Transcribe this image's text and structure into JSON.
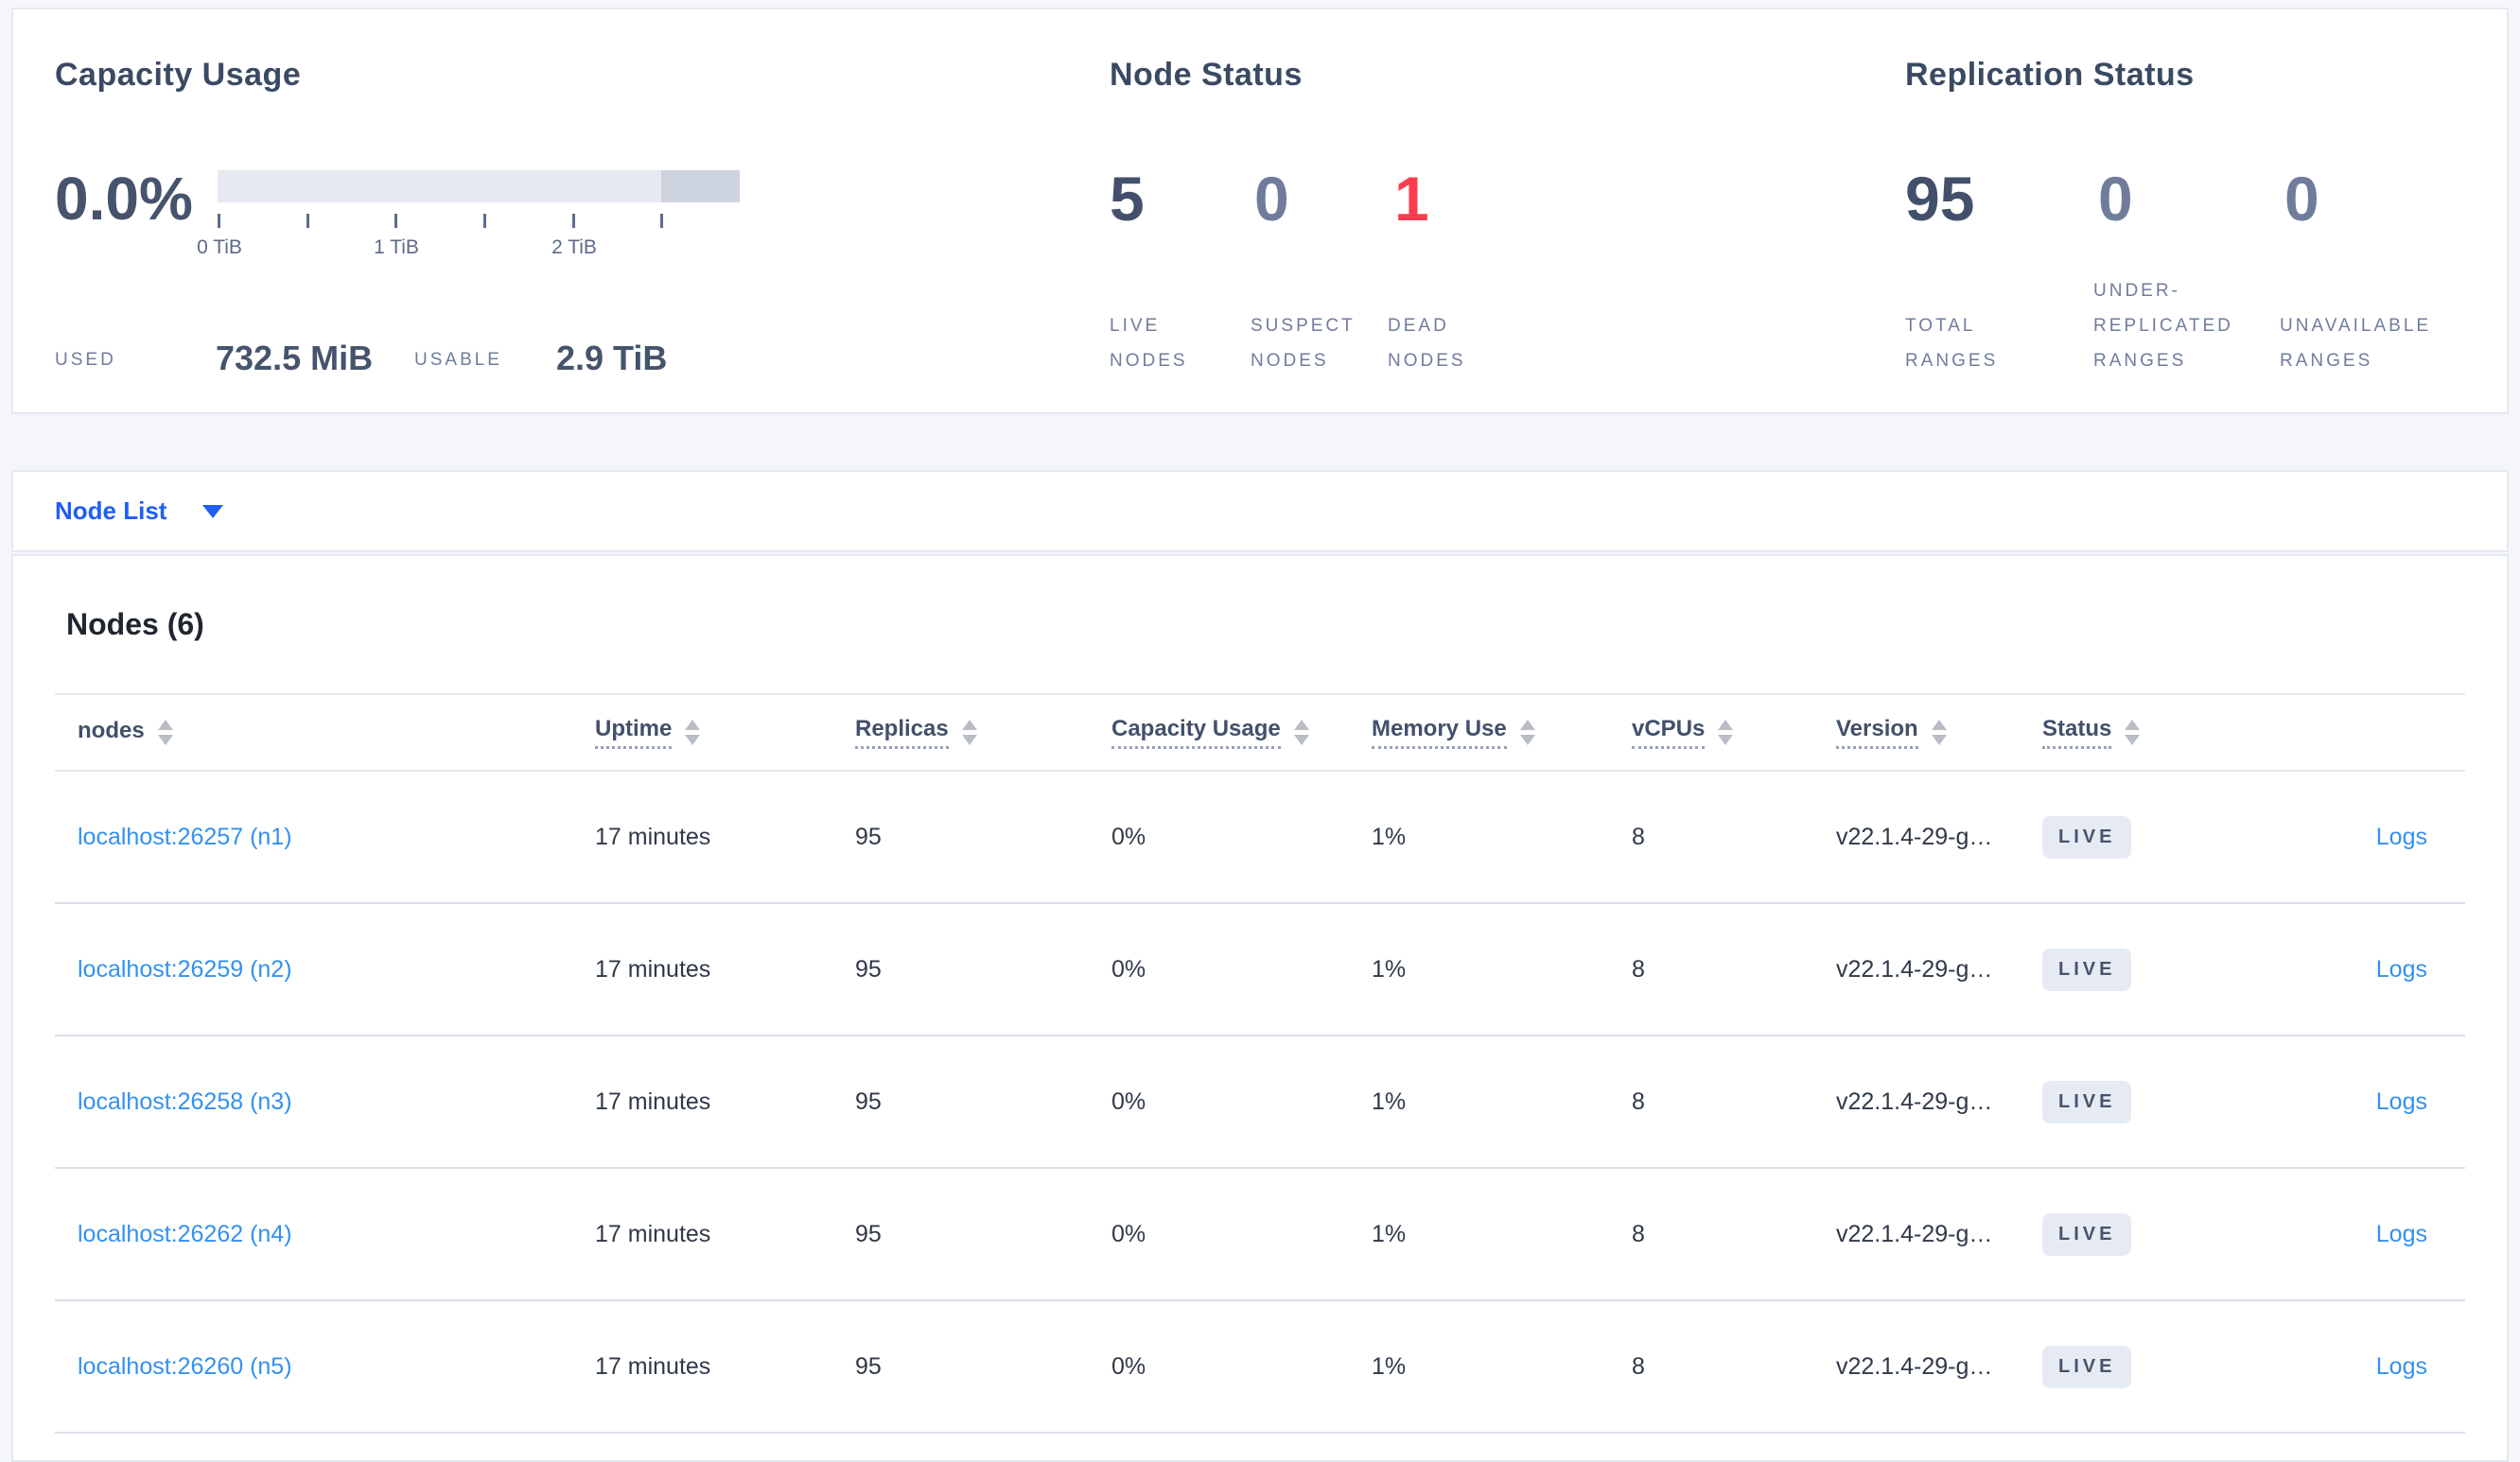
{
  "colors": {
    "page_bg": "#f4f6fa",
    "card_bg": "#ffffff",
    "primary_blue": "#1f5ff5",
    "link_blue": "#3291f0",
    "dead_red": "#fc3d4e",
    "metric_dark": "#43506b",
    "metric_dim": "#6f7c9c",
    "bar_track": "#e6e9f0",
    "bar_dark_segment": "#cdd2df",
    "badge_bg": "#e6ebf3"
  },
  "summary": {
    "capacity": {
      "title": "Capacity Usage",
      "percent": "0.0%",
      "tick_labels": [
        "0 TiB",
        "1 TiB",
        "2 TiB"
      ],
      "used_label": "USED",
      "used_value": "732.5 MiB",
      "usable_label": "USABLE",
      "usable_value": "2.9 TiB"
    },
    "node_status": {
      "title": "Node Status",
      "metrics": [
        {
          "value": "5",
          "label": "LIVE NODES"
        },
        {
          "value": "0",
          "label": "SUSPECT NODES"
        },
        {
          "value": "1",
          "label": "DEAD NODES"
        }
      ]
    },
    "replication": {
      "title": "Replication Status",
      "metrics": [
        {
          "value": "95",
          "label": "TOTAL RANGES"
        },
        {
          "value": "0",
          "label": "UNDER-REPLICATED RANGES"
        },
        {
          "value": "0",
          "label": "UNAVAILABLE RANGES"
        }
      ]
    }
  },
  "node_list": {
    "label": "Node List"
  },
  "nodes_section": {
    "title": "Nodes (6)",
    "logs_label": "Logs",
    "columns": [
      {
        "label": "nodes"
      },
      {
        "label": "Uptime"
      },
      {
        "label": "Replicas"
      },
      {
        "label": "Capacity Usage"
      },
      {
        "label": "Memory Use"
      },
      {
        "label": "vCPUs"
      },
      {
        "label": "Version"
      },
      {
        "label": "Status"
      }
    ],
    "rows": [
      {
        "node": "localhost:26257 (n1)",
        "uptime": "17 minutes",
        "replicas": "95",
        "capacity": "0%",
        "memory": "1%",
        "vcpus": "8",
        "version": "v22.1.4-29-g…",
        "status": "LIVE"
      },
      {
        "node": "localhost:26259 (n2)",
        "uptime": "17 minutes",
        "replicas": "95",
        "capacity": "0%",
        "memory": "1%",
        "vcpus": "8",
        "version": "v22.1.4-29-g…",
        "status": "LIVE"
      },
      {
        "node": "localhost:26258 (n3)",
        "uptime": "17 minutes",
        "replicas": "95",
        "capacity": "0%",
        "memory": "1%",
        "vcpus": "8",
        "version": "v22.1.4-29-g…",
        "status": "LIVE"
      },
      {
        "node": "localhost:26262 (n4)",
        "uptime": "17 minutes",
        "replicas": "95",
        "capacity": "0%",
        "memory": "1%",
        "vcpus": "8",
        "version": "v22.1.4-29-g…",
        "status": "LIVE"
      },
      {
        "node": "localhost:26260 (n5)",
        "uptime": "17 minutes",
        "replicas": "95",
        "capacity": "0%",
        "memory": "1%",
        "vcpus": "8",
        "version": "v22.1.4-29-g…",
        "status": "LIVE"
      }
    ]
  }
}
